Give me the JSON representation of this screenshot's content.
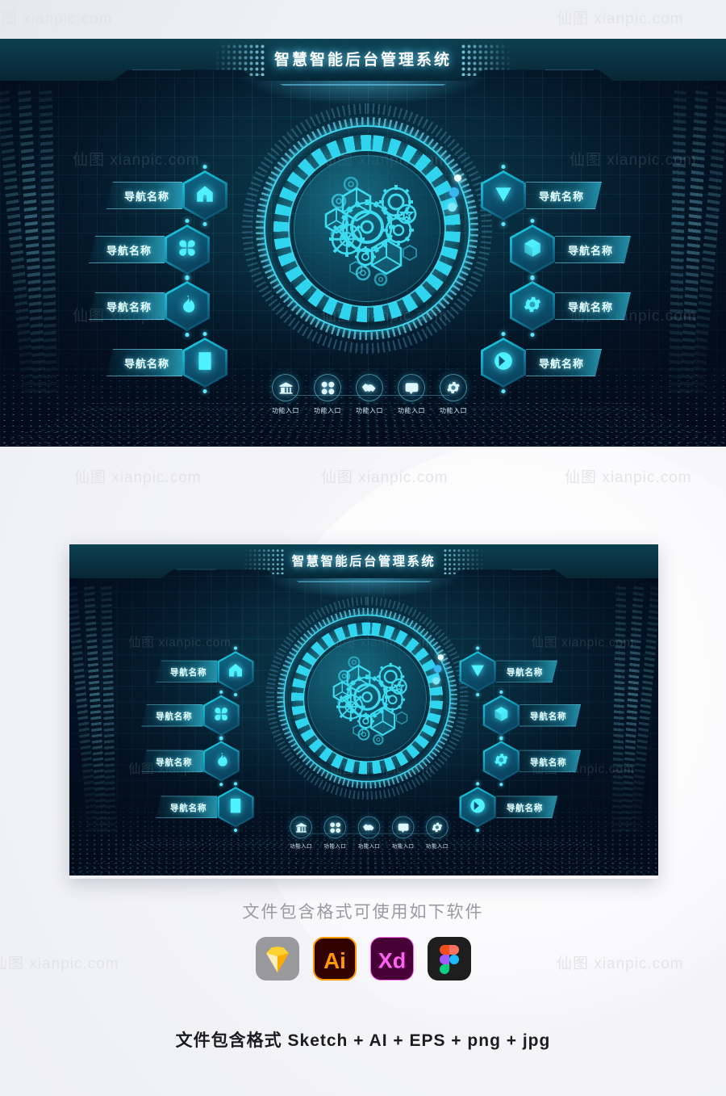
{
  "header": {
    "title": "智慧智能后台管理系统"
  },
  "nav_left": [
    {
      "label": "导航名称",
      "icon": "home-icon"
    },
    {
      "label": "导航名称",
      "icon": "grid-flower-icon"
    },
    {
      "label": "导航名称",
      "icon": "flame-icon"
    },
    {
      "label": "导航名称",
      "icon": "document-icon"
    }
  ],
  "nav_right": [
    {
      "label": "导航名称",
      "icon": "triangle-down-icon"
    },
    {
      "label": "导航名称",
      "icon": "cube-icon"
    },
    {
      "label": "导航名称",
      "icon": "gear-icon"
    },
    {
      "label": "导航名称",
      "icon": "circle-chevron-right-icon"
    }
  ],
  "entries": [
    {
      "label": "功能入口",
      "icon": "bank-icon"
    },
    {
      "label": "功能入口",
      "icon": "grid-flower-icon"
    },
    {
      "label": "功能入口",
      "icon": "handshake-icon"
    },
    {
      "label": "功能入口",
      "icon": "chat-bubble-icon"
    },
    {
      "label": "功能入口",
      "icon": "gear-icon"
    }
  ],
  "hud": {
    "center_icon": "gear-cluster-icon",
    "indicator_dots": 3
  },
  "footer": {
    "software_heading": "文件包含格式可使用如下软件",
    "formats_line": "文件包含格式 Sketch + AI + EPS + png + jpg",
    "apps": [
      {
        "name": "Sketch",
        "icon": "sketch-icon"
      },
      {
        "name": "Ai",
        "icon": "illustrator-icon"
      },
      {
        "name": "Xd",
        "icon": "adobe-xd-icon"
      },
      {
        "name": "Figma",
        "icon": "figma-icon"
      }
    ]
  },
  "watermark": {
    "text": "仙图 xianpic.com"
  },
  "colors": {
    "accent_cyan": "#3ed8f0",
    "panel_dark": "#03101f",
    "header_teal": "#0a3243",
    "title_white": "#ffffff"
  }
}
